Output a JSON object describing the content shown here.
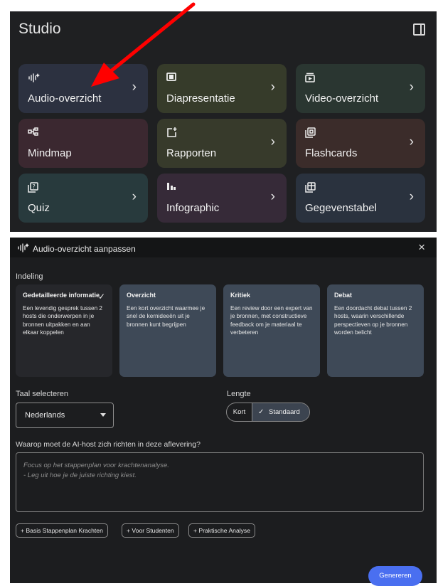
{
  "studio": {
    "title": "Studio",
    "tiles": [
      {
        "label": "Audio-overzicht",
        "icon": "audio-waveform-icon",
        "bg": "#2c3140",
        "chevron": "›"
      },
      {
        "label": "Diapresentatie",
        "icon": "slides-icon",
        "bg": "#363b2a",
        "chevron": "›"
      },
      {
        "label": "Video-overzicht",
        "icon": "video-icon",
        "bg": "#2a3631",
        "chevron": "›"
      },
      {
        "label": "Mindmap",
        "icon": "mindmap-icon",
        "bg": "#3b2830",
        "chevron": ""
      },
      {
        "label": "Rapporten",
        "icon": "reports-icon",
        "bg": "#373a2b",
        "chevron": "›"
      },
      {
        "label": "Flashcards",
        "icon": "flashcards-icon",
        "bg": "#3b2c2a",
        "chevron": "›"
      },
      {
        "label": "Quiz",
        "icon": "quiz-icon",
        "bg": "#283a3d",
        "chevron": "›"
      },
      {
        "label": "Infographic",
        "icon": "infographic-icon",
        "bg": "#362a38",
        "chevron": "›"
      },
      {
        "label": "Gegevenstabel",
        "icon": "data-table-icon",
        "bg": "#2a323e",
        "chevron": "›"
      }
    ]
  },
  "dialog": {
    "title": "Audio-overzicht aanpassen",
    "close": "×",
    "format_label": "Indeling",
    "formats": [
      {
        "title": "Gedetailleerde informatie",
        "desc": "Een levendig gesprek tussen 2 hosts die onderwerpen in je bronnen uitpakken en aan elkaar koppelen",
        "selected": true
      },
      {
        "title": "Overzicht",
        "desc": "Een kort overzicht waarmee je snel de kernideeën uit je bronnen kunt begrijpen",
        "selected": false
      },
      {
        "title": "Kritiek",
        "desc": "Een review door een expert van je bronnen, met constructieve feedback om je materiaal te verbeteren",
        "selected": false
      },
      {
        "title": "Debat",
        "desc": "Een doordacht debat tussen 2 hosts, waarin verschillende perspectieven op je bronnen worden belicht",
        "selected": false
      }
    ],
    "language_label": "Taal selecteren",
    "language_value": "Nederlands",
    "length_label": "Lengte",
    "length_options": [
      "Kort",
      "Standaard"
    ],
    "length_selected": "Standaard",
    "focus_label": "Waarop moet de AI-host zich richten in deze aflevering?",
    "focus_placeholder_line1": "Focus op het stappenplan voor krachtenanalyse.",
    "focus_placeholder_line2": "- Leg uit hoe je de juiste richting kiest.",
    "chips": [
      "+ Basis Stappenplan Krachten",
      "+ Voor Studenten",
      "+ Praktische Analyse"
    ],
    "generate_label": "Genereren"
  },
  "colors": {
    "annotation_arrow": "#ff0000",
    "accent_button": "#4a6ff0",
    "selected_card": "#26272b",
    "card": "#3e4957"
  }
}
